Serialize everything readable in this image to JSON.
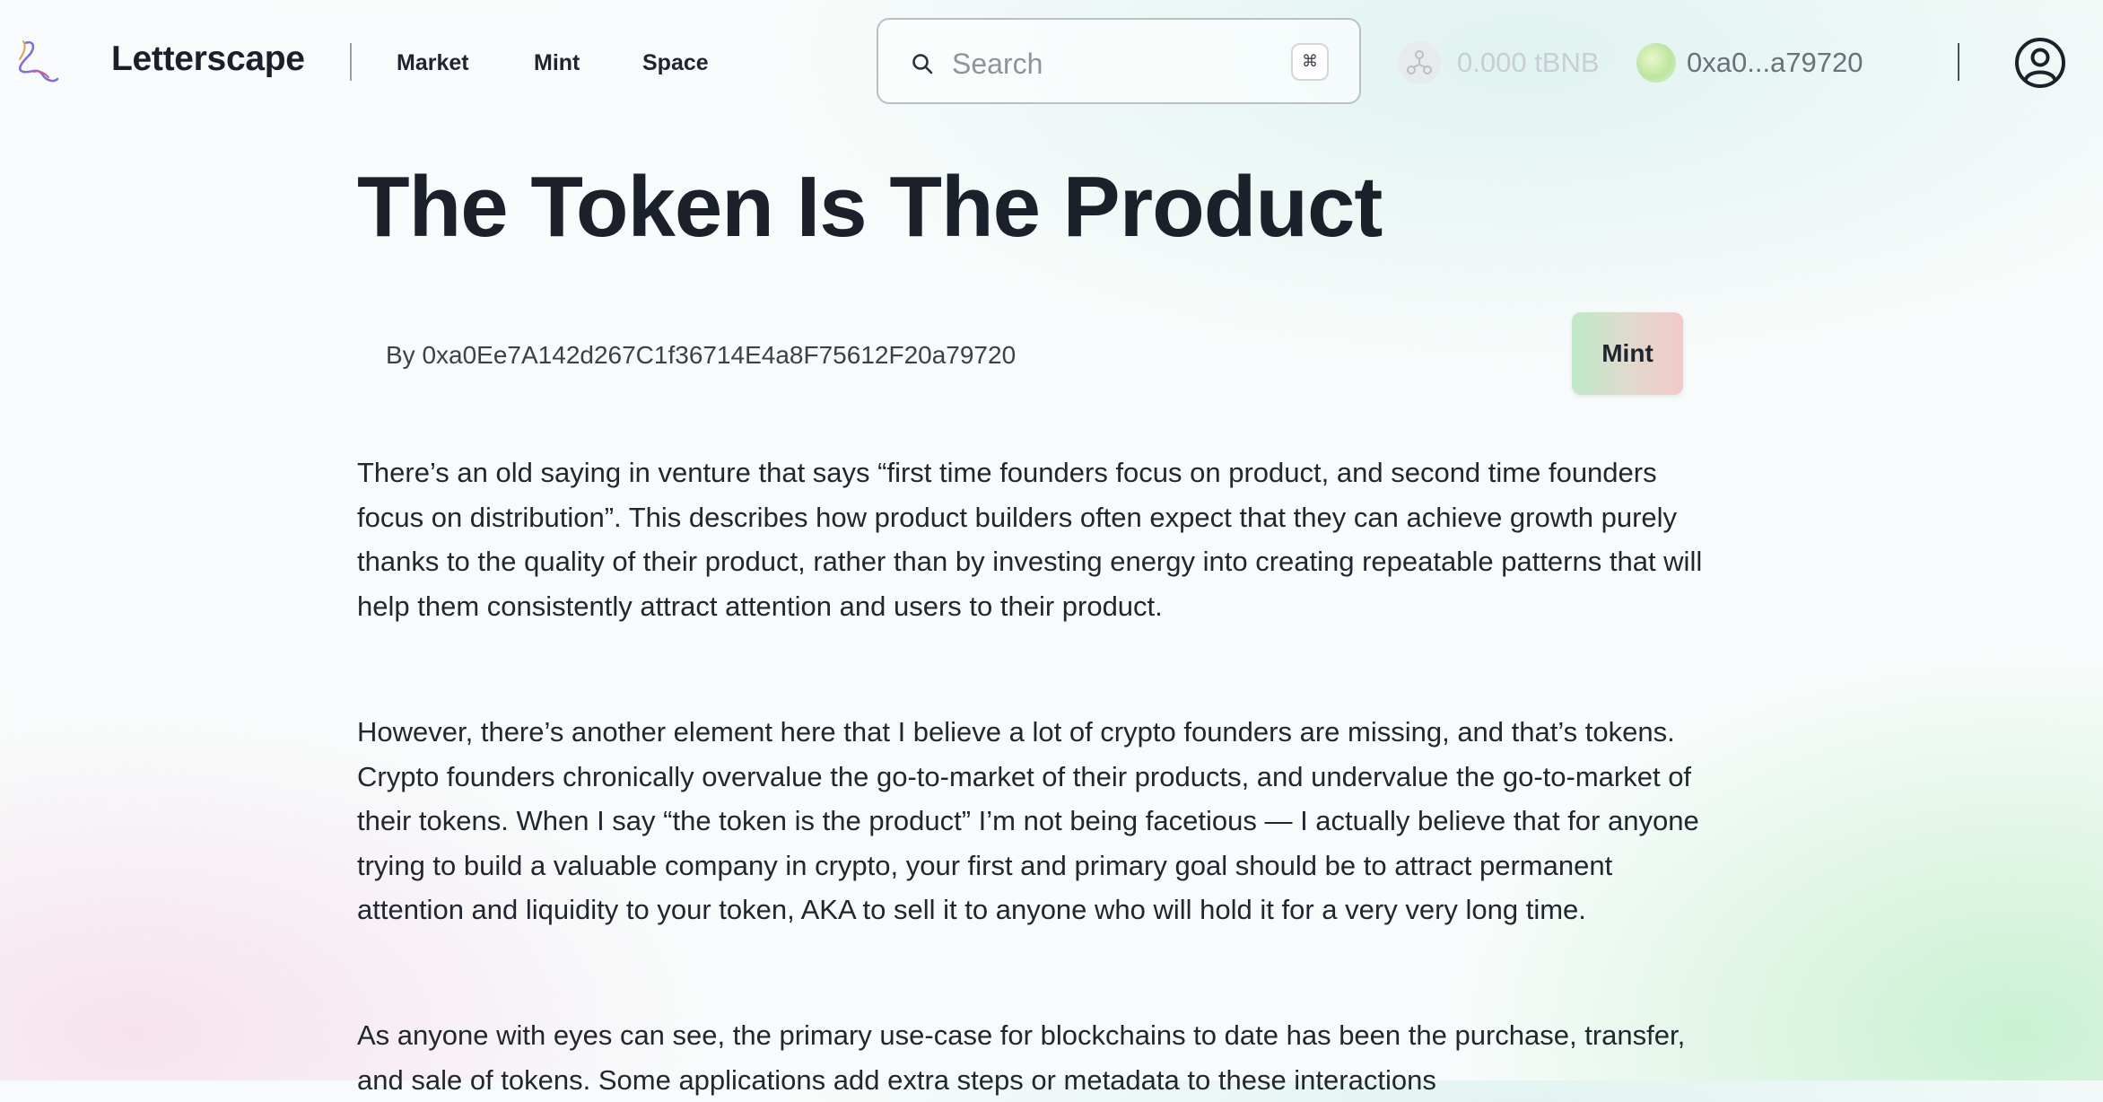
{
  "header": {
    "brand": "Letterscape",
    "nav": [
      "Market",
      "Mint",
      "Space"
    ],
    "search": {
      "placeholder": "Search",
      "shortcut": "⌘"
    },
    "balance": "0.000 tBNB",
    "wallet_address": "0xa0...a79720"
  },
  "article": {
    "title": "The Token Is The Product",
    "byline": "By 0xa0Ee7A142d267C1f36714E4a8F75612F20a79720",
    "mint_label": "Mint",
    "paragraphs": [
      "There’s an old saying in venture that says “first time founders focus on product, and second time founders focus on distribution”. This describes how product builders often expect that they can achieve growth purely thanks to the quality of their product, rather than by investing energy into creating repeatable patterns that will help them consistently attract attention and users to their product.",
      "However, there’s another element here that I believe a lot of crypto founders are missing, and that’s tokens. Crypto founders chronically overvalue the go-to-market of their products, and undervalue the go-to-market of their tokens. When I say “the token is the product” I’m not being facetious — I actually believe that for anyone trying to build a valuable company in crypto, your first and primary goal should be to attract permanent attention and liquidity to your token, AKA to sell it to anyone who will hold it for a very very long time.",
      "As anyone with eyes can see, the primary use-case for blockchains to date has been the purchase, transfer, and sale of tokens. Some applications add extra steps or metadata to these interactions"
    ]
  }
}
